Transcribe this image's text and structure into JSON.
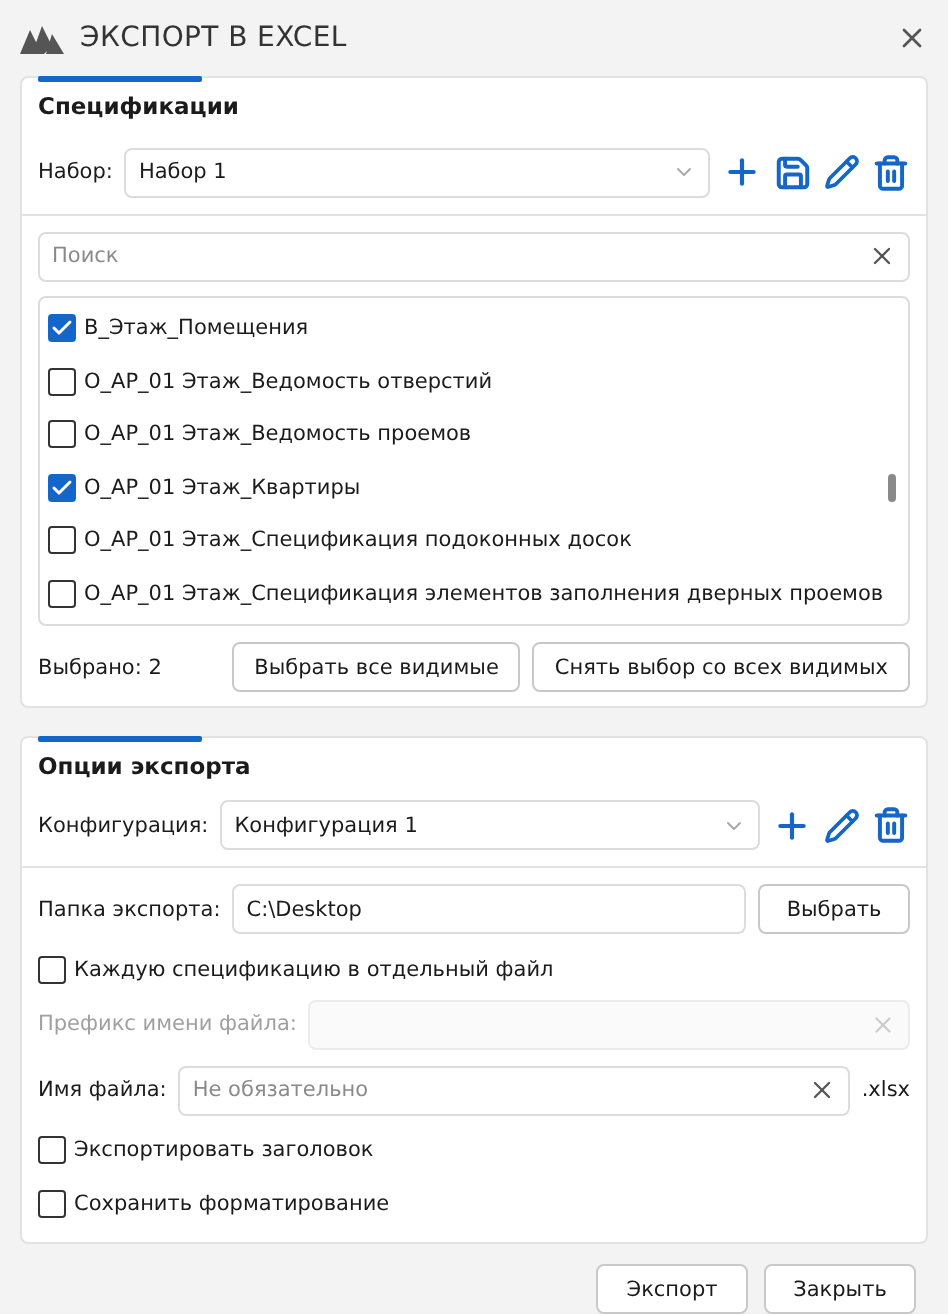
{
  "window": {
    "title": "ЭКСПОРТ В EXCEL"
  },
  "specifications": {
    "title": "Спецификации",
    "set_field": {
      "label": "Набор:",
      "value": "Набор 1"
    },
    "search": {
      "placeholder": "Поиск"
    },
    "items": [
      {
        "label": "В_Этаж_Помещения",
        "checked": true
      },
      {
        "label": "О_АР_01 Этаж_Ведомость отверстий",
        "checked": false
      },
      {
        "label": "О_АР_01 Этаж_Ведомость проемов",
        "checked": false
      },
      {
        "label": "О_АР_01 Этаж_Квартиры",
        "checked": true
      },
      {
        "label": "О_АР_01 Этаж_Спецификация подоконных досок",
        "checked": false
      },
      {
        "label": "О_АР_01 Этаж_Спецификация элементов заполнения дверных проемов",
        "checked": false
      }
    ],
    "selected_count": "Выбрано: 2",
    "buttons": [
      "Выбрать все видимые",
      "Снять выбор со всех видимых"
    ]
  },
  "export_options": {
    "title": "Опции экспорта",
    "config_field": {
      "label": "Конфигурация:",
      "value": "Конфигурация 1"
    },
    "folder_field": {
      "label": "Папка экспорта:",
      "value": "C:\\Desktop",
      "button": "Выбрать"
    },
    "separate_files": {
      "label": "Каждую спецификацию в отдельный файл",
      "checked": false
    },
    "prefix_field": {
      "label": "Префикс имени файла:",
      "disabled": true
    },
    "file_name_field": {
      "label": "Имя файла:",
      "placeholder": "Не обязательно",
      "suffix": ".xlsx"
    },
    "options": [
      {
        "label": "Экспортировать заголовок",
        "checked": false
      },
      {
        "label": "Сохранить форматирование",
        "checked": false
      }
    ]
  },
  "footer": {
    "buttons": [
      "Экспорт",
      "Закрыть"
    ]
  }
}
